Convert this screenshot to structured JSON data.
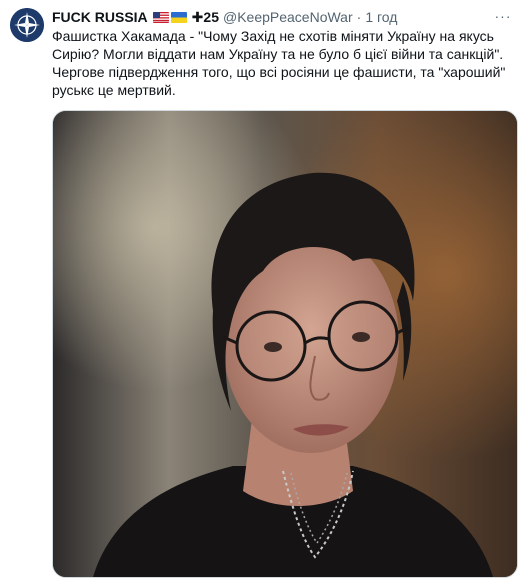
{
  "tweet": {
    "author": {
      "display_name": "FUCK RUSSIA",
      "badges": [
        "flag-us-icon",
        "flag-ukraine-icon"
      ],
      "badge_text": "✚25",
      "handle": "@KeepPeaceNoWar",
      "separator": "·",
      "time": "1 год",
      "avatar_icon": "nato-compass-icon"
    },
    "more_icon": "more-options-icon",
    "more_label": "···",
    "body_lines": [
      "Фашистка Хакамада - \"Чому Захід не схотів міняти Україну на якусь",
      "Сирію? Могли віддати нам Україну та не було б цієї війни та санкцій\".",
      "Чергове підвердження того, що всі росіяни це фашисти, та \"хароший\"",
      "руськє це мертвий."
    ],
    "media": {
      "type": "photo",
      "icon": "portrait-photo"
    }
  },
  "colors": {
    "text": "#0f1419",
    "secondary": "#536471",
    "avatar_bg": "#1d3a6b",
    "media_border": "#cfd9de"
  }
}
